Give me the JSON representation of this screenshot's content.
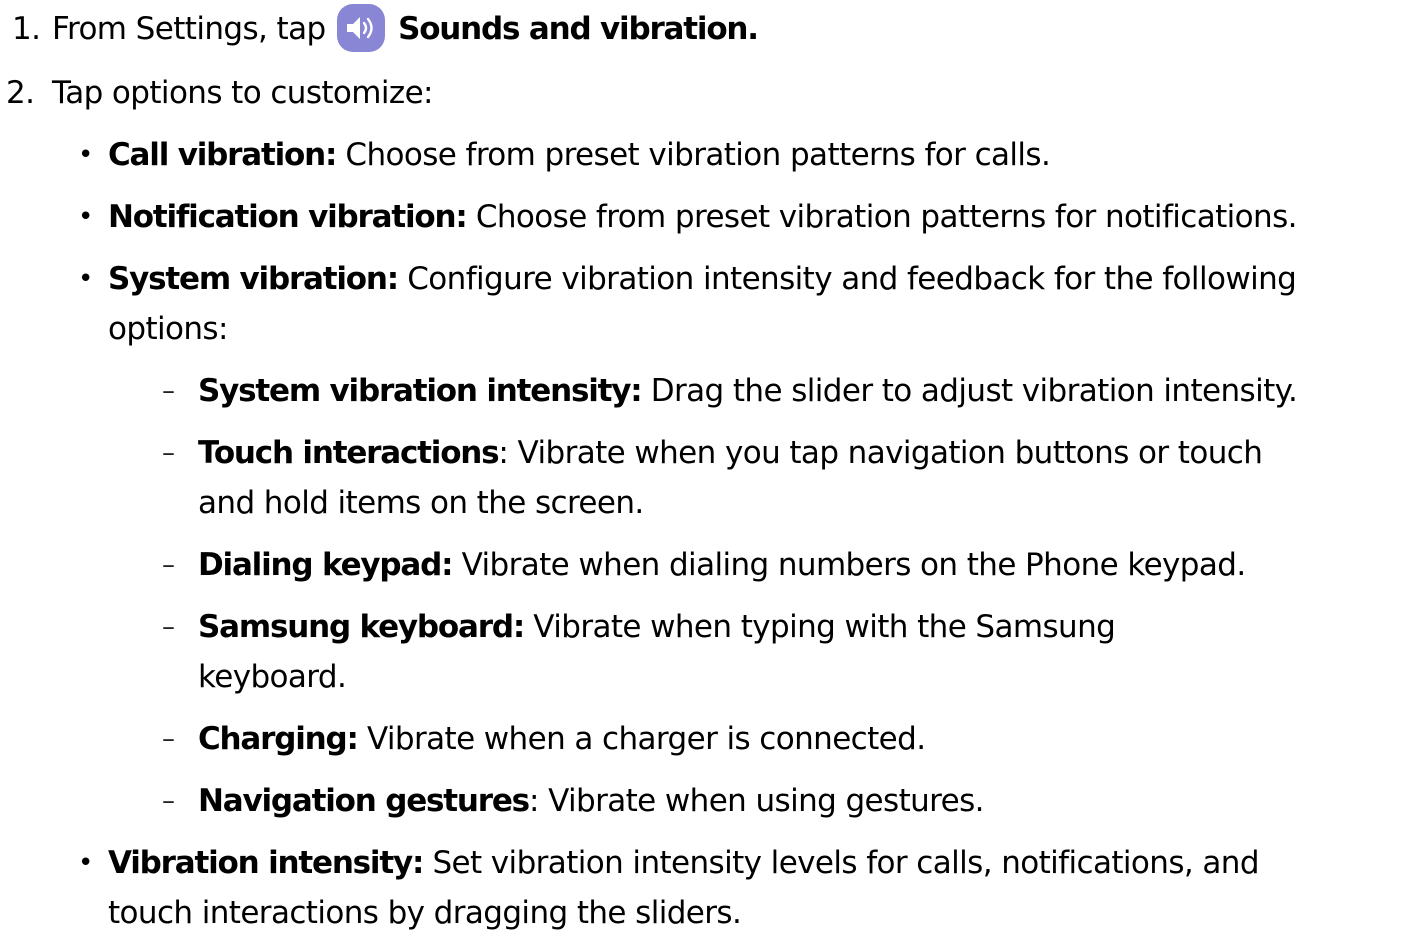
{
  "steps": [
    {
      "number": "1.",
      "text_before_icon": "From Settings, tap",
      "icon": "sound-speaker-icon",
      "icon_color": "#8a86d6",
      "bold_after_icon": "Sounds and vibration."
    },
    {
      "number": "2.",
      "text": "Tap options to customize:"
    }
  ],
  "options": [
    {
      "term": "Call vibration:",
      "desc": "Choose from preset vibration patterns for calls."
    },
    {
      "term": "Notification vibration:",
      "desc": "Choose from preset vibration patterns for notifications."
    },
    {
      "term": "System vibration:",
      "desc_line1": "Configure vibration intensity and feedback for the following",
      "desc_line2": "options:",
      "sub_options": [
        {
          "term": "System vibration intensity:",
          "desc": "Drag the slider to adjust vibration intensity."
        },
        {
          "term": "Touch interactions",
          "sep": ":",
          "desc_line1": "Vibrate when you tap navigation buttons or touch",
          "desc_line2": "and hold items on the screen."
        },
        {
          "term": "Dialing keypad:",
          "desc": "Vibrate when dialing numbers on the Phone keypad."
        },
        {
          "term": "Samsung keyboard:",
          "desc_line1": "Vibrate when typing with the Samsung",
          "desc_line2": "keyboard."
        },
        {
          "term": "Charging:",
          "desc": "Vibrate when a charger is connected."
        },
        {
          "term": "Navigation gestures",
          "sep": ":",
          "desc": "Vibrate when using gestures."
        }
      ]
    },
    {
      "term": "Vibration intensity:",
      "desc_line1": "Set vibration intensity levels for calls, notifications, and",
      "desc_line2": "touch interactions by dragging the sliders."
    }
  ],
  "bullet_char": "•",
  "dash_char": "–"
}
